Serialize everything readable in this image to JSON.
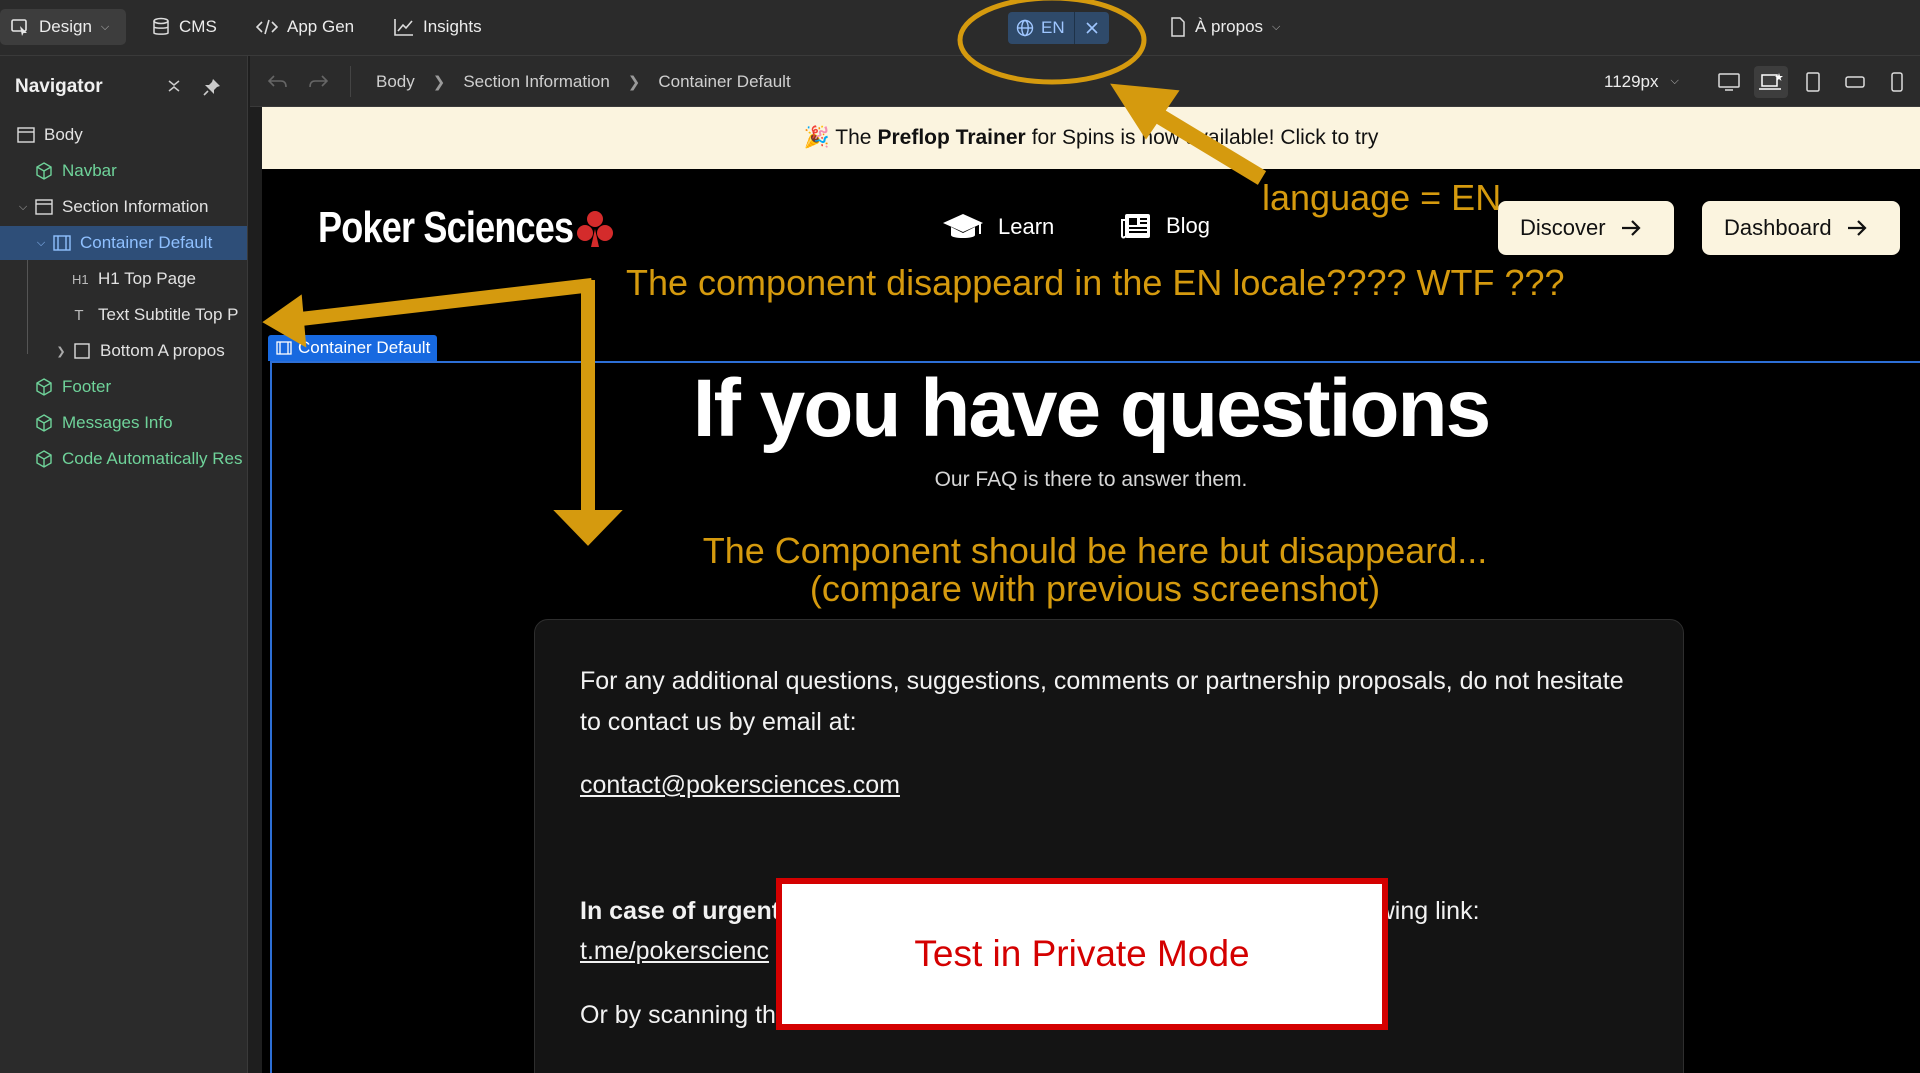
{
  "topbar": {
    "design_label": "Design",
    "cms_label": "CMS",
    "appgen_label": "App Gen",
    "insights_label": "Insights",
    "locale_label": "EN",
    "page_label": "À propos"
  },
  "subbar": {
    "breadcrumbs": [
      "Body",
      "Section Information",
      "Container Default"
    ],
    "width_label": "1129px"
  },
  "navigator": {
    "title": "Navigator",
    "items": [
      {
        "label": "Body"
      },
      {
        "label": "Navbar"
      },
      {
        "label": "Section Information"
      },
      {
        "label": "Container Default"
      },
      {
        "label": "H1 Top Page",
        "tag": "H1"
      },
      {
        "label": "Text Subtitle Top P",
        "tag": "T"
      },
      {
        "label": "Bottom A propos"
      },
      {
        "label": "Footer"
      },
      {
        "label": "Messages Info"
      },
      {
        "label": "Code Automatically Res"
      }
    ]
  },
  "site": {
    "promo_prefix": "🎉 The ",
    "promo_bold": "Preflop Trainer",
    "promo_suffix": " for Spins is now available! Click to try",
    "logo": "Poker Sciences",
    "nav_learn": "Learn",
    "nav_blog": "Blog",
    "cta_discover": "Discover",
    "cta_dashboard": "Dashboard",
    "selection_tag": "Container Default",
    "hero_title": "If you have questions",
    "hero_subtitle": "Our FAQ is there to answer them.",
    "faq_p1": "For any additional questions, suggestions, comments or partnership proposals, do not hesitate to contact us by email at:",
    "faq_email": "contact@pokersciences.com",
    "faq_urgent_bold": "In case of urgent",
    "faq_urgent_right": "e following link:",
    "faq_tme": "t.me/pokerscienc",
    "faq_scan": "Or by scanning th"
  },
  "annotations": {
    "language": "language = EN",
    "disappeared": "The component disappeard in the EN locale???? WTF ???",
    "should_be_here_1": "The Component should be here but disappeard...",
    "should_be_here_2": "(compare with previous screenshot)",
    "private_mode": "Test in Private Mode"
  },
  "colors": {
    "annotation": "#d59a0e",
    "selection": "#1769e0",
    "alert": "#d40000",
    "cream": "#fbf4df"
  }
}
